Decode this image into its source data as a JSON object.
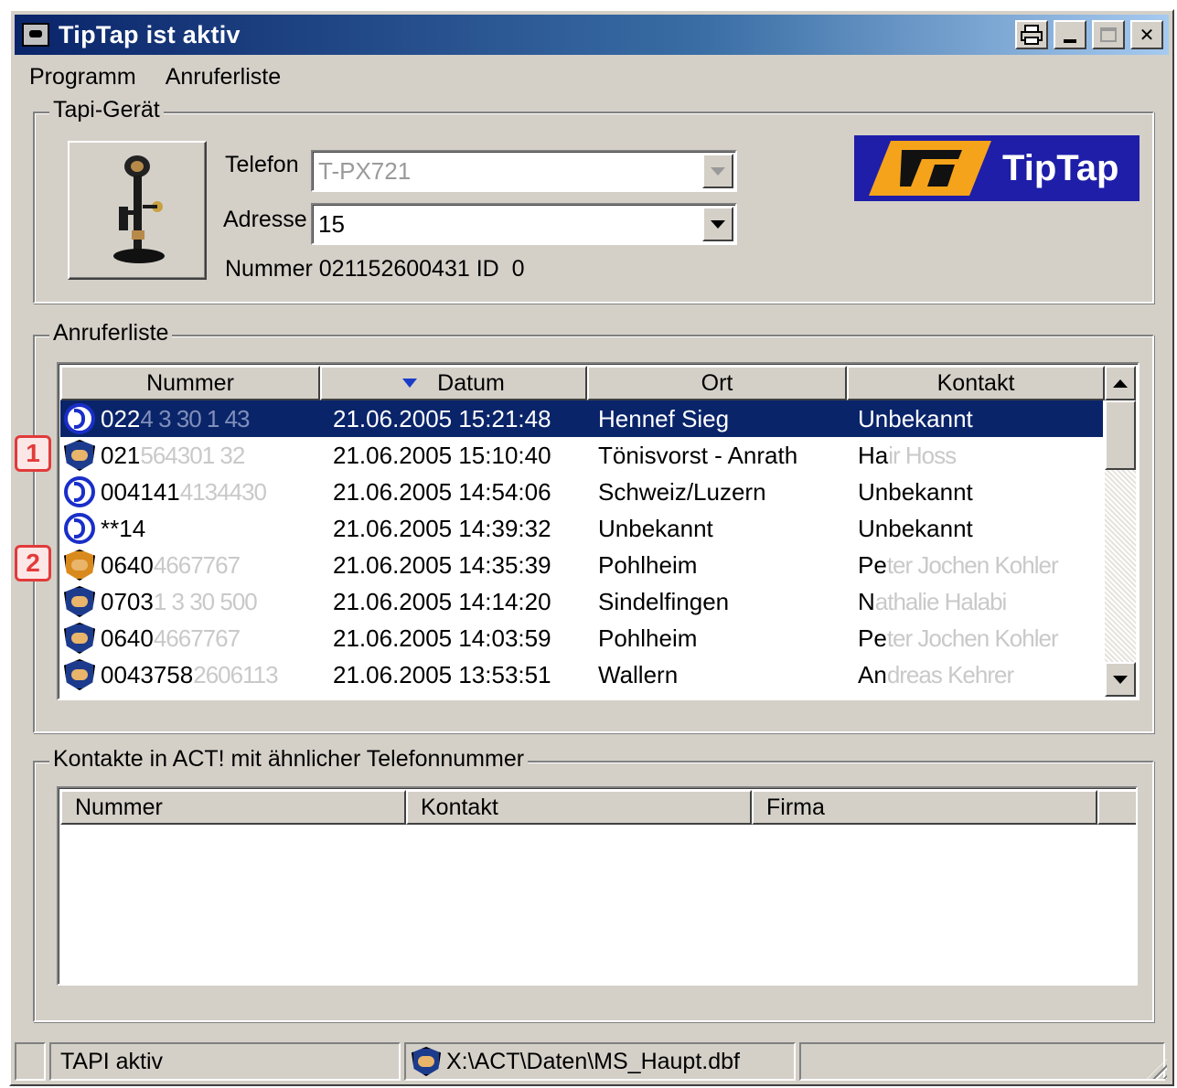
{
  "window": {
    "title": "TipTap ist aktiv"
  },
  "menu": {
    "items": [
      "Programm",
      "Anruferliste"
    ]
  },
  "tapi": {
    "group_label": "Tapi-Gerät",
    "telefon_label": "Telefon",
    "telefon_value": "T-PX721",
    "adresse_label": "Adresse",
    "adresse_value": "15",
    "nummer_line": "Nummer 021152600431 ID  0",
    "logo_text": "TipTap"
  },
  "calls": {
    "group_label": "Anruferliste",
    "columns": [
      "Nummer",
      "Datum",
      "Ort",
      "Kontakt"
    ],
    "rows": [
      {
        "icon": "incoming-call-icon",
        "number": "022",
        "number_masked": "4 3 30 1 43",
        "date": "21.06.2005 15:21:48",
        "ort": "Hennef Sieg",
        "kontakt": "Unbekannt",
        "kontakt_masked": "",
        "selected": true,
        "marker": ""
      },
      {
        "icon": "contact-handshake-icon",
        "number": "021",
        "number_masked": "564301 32",
        "date": "21.06.2005 15:10:40",
        "ort": "Tönisvorst - Anrath",
        "kontakt": "Ha",
        "kontakt_masked": "ir Hoss",
        "selected": false,
        "marker": "1"
      },
      {
        "icon": "incoming-call-icon",
        "number": "004141",
        "number_masked": "4134430",
        "date": "21.06.2005 14:54:06",
        "ort": "Schweiz/Luzern",
        "kontakt": "Unbekannt",
        "kontakt_masked": "",
        "selected": false,
        "marker": ""
      },
      {
        "icon": "incoming-call-icon",
        "number": "**14",
        "number_masked": "",
        "date": "21.06.2005 14:39:32",
        "ort": "Unbekannt",
        "kontakt": "Unbekannt",
        "kontakt_masked": "",
        "selected": false,
        "marker": ""
      },
      {
        "icon": "contact-handshake-orange-icon",
        "number": "0640",
        "number_masked": "4667767",
        "date": "21.06.2005 14:35:39",
        "ort": "Pohlheim",
        "kontakt": "Pe",
        "kontakt_masked": "ter Jochen Kohler",
        "selected": false,
        "marker": "2"
      },
      {
        "icon": "contact-handshake-icon",
        "number": "0703",
        "number_masked": "1 3 30 500",
        "date": "21.06.2005 14:14:20",
        "ort": "Sindelfingen",
        "kontakt": "N",
        "kontakt_masked": "athalie Halabi",
        "selected": false,
        "marker": ""
      },
      {
        "icon": "contact-handshake-icon",
        "number": "0640",
        "number_masked": "4667767",
        "date": "21.06.2005 14:03:59",
        "ort": "Pohlheim",
        "kontakt": "Pe",
        "kontakt_masked": "ter Jochen Kohler",
        "selected": false,
        "marker": ""
      },
      {
        "icon": "contact-handshake-icon",
        "number": "0043758",
        "number_masked": "2606113",
        "date": "21.06.2005 13:53:51",
        "ort": "Wallern",
        "kontakt": "An",
        "kontakt_masked": "dreas Kehrer",
        "selected": false,
        "marker": ""
      }
    ]
  },
  "contacts": {
    "group_label": "Kontakte in ACT! mit ähnlicher Telefonnummer",
    "columns": [
      "Nummer",
      "Kontakt",
      "Firma"
    ]
  },
  "status": {
    "tapi": "TAPI aktiv",
    "path": "X:\\ACT\\Daten\\MS_Haupt.dbf"
  },
  "colors": {
    "selection": "#0a246a",
    "title_start": "#0a246a",
    "logo_bg": "#1e1ea8",
    "logo_accent": "#f5a31a",
    "marker": "#e23a3a"
  }
}
